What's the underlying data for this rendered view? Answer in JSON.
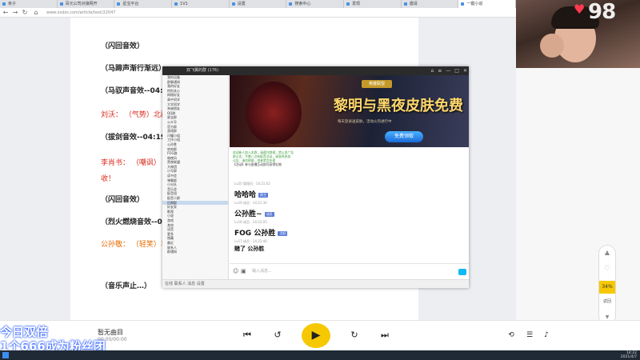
{
  "tabs": [
    "亲子",
    "百元公司对接网开",
    "星宝平台",
    "1V1",
    "设置",
    "搜索中心",
    "发现",
    "邀请",
    "一键小说"
  ],
  "address": {
    "url": "www.xxdzs.com/article/text/22047"
  },
  "script_lines": [
    {
      "text": "（闪回音效）",
      "style": "bold"
    },
    {
      "text": "（马蹄声渐行渐远）",
      "style": "bold"
    },
    {
      "text": "（马驭声音效--04:0",
      "style": "bold"
    },
    {
      "speaker": "刘沃：",
      "text": "（气势）北疆…",
      "style": "red"
    },
    {
      "text": "（拔剑音效--04:19",
      "style": "bold"
    },
    {
      "speaker": "李肖书：",
      "text": "（嘲讽）",
      "style": "red"
    },
    {
      "text": "收！",
      "style": "red"
    },
    {
      "text": "（闪回音效）",
      "style": "bold"
    },
    {
      "text": "（烈火燃烧音效--04",
      "style": "bold"
    },
    {
      "speaker": "公孙敬：",
      "text": "（轻笑）丰",
      "style": "orange"
    },
    {
      "text": "（音乐声止…）",
      "style": "bold"
    }
  ],
  "streamer": {
    "count": "98",
    "heart_icon": "heart-icon"
  },
  "side_control": {
    "zoom": "34%",
    "label": "返回"
  },
  "qq": {
    "title": "双飞翼的群 (176)",
    "contacts": [
      "我的设备",
      "群聊通知",
      "我的好友",
      "特别关心",
      "网络好友",
      "高中同学",
      "大学同学",
      "亲戚朋友",
      "QQ群",
      "星宝群",
      "公众号",
      "官方群",
      "游戏群",
      "闪耀小组",
      "工作小组",
      "公孙胜",
      "哈哈群",
      "FOG群",
      "暗夜风",
      "黑夜联盟",
      "大神团",
      "小号群",
      "读书会",
      "弹幕姬",
      "小分队",
      "音乐会",
      "配音组",
      "配音二群",
      "后期群",
      "好友家",
      "影视",
      "小说",
      "游戏",
      "其他",
      "语音",
      "更多",
      "隐藏",
      "最近",
      "联系人",
      "群通知"
    ],
    "banner": {
      "badge": "英雄联盟",
      "title": "黎明与黑夜皮肤免费",
      "subtitle": "每天登录送皮肤，活动火热进行中",
      "button": "免费领取"
    },
    "notices": [
      "欢迎新人加入本群，请遵守群规，禁止发广告",
      "群公告：今晚八点有配音活动，请准时参加",
      "公告：请勿刷屏，违者禁言处理",
      "【活动】参与直播互动即可获得礼物"
    ],
    "messages": [
      {
        "meta": "Lv20 管理员 · 14:21:02",
        "text": "哈哈哈",
        "tag": "群主"
      },
      {
        "meta": "Lv19 成员 · 14:21:30",
        "text": "公孙胜~",
        "tag": "成员"
      },
      {
        "meta": "Lv18 成员 · 14:22:05",
        "text": "FOG  公孙胜",
        "tag": "活跃"
      },
      {
        "meta": "Lv17 成员 · 14:22:40",
        "text": "赌了  公孙胜",
        "tag": ""
      }
    ],
    "input_placeholder": "输入消息...",
    "bottom": "在线  联系人  消息  设置"
  },
  "player": {
    "title": "暂无曲目",
    "time": "00:00/00:00"
  },
  "ticker": {
    "line1": "今日双倍",
    "line2": "1个666成为粉丝团"
  },
  "clock": {
    "time": "14:22",
    "date": "2021/4/7"
  }
}
